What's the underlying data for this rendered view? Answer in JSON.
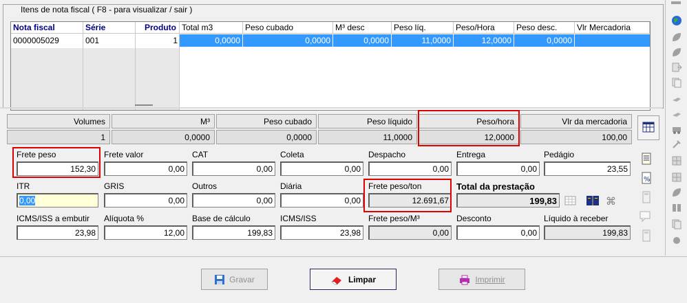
{
  "items_group": {
    "title": "Itens de nota fiscal ( F8 - para visualizar / sair )",
    "columns": [
      "Nota fiscal",
      "Série",
      "Produto",
      "Total m3",
      "Peso cubado",
      "M³ desc",
      "Peso líq.",
      "Peso/Hora",
      "Peso desc.",
      "Vlr Mercadoria"
    ],
    "row": [
      "0000005029",
      "001",
      "1",
      "0,0000",
      "0,0000",
      "0,0000",
      "11,0000",
      "12,0000",
      "0,0000",
      ""
    ]
  },
  "summary": {
    "labels": [
      "Volumes",
      "M³",
      "Peso cubado",
      "Peso líquido",
      "Peso/hora",
      "Vlr da mercadoria"
    ],
    "values": [
      "1",
      "0,0000",
      "0,0000",
      "11,0000",
      "12,0000",
      "100,00"
    ]
  },
  "fields": {
    "frete_peso": {
      "label": "Frete peso",
      "value": "152,30"
    },
    "frete_valor": {
      "label": "Frete valor",
      "value": "0,00"
    },
    "cat": {
      "label": "CAT",
      "value": "0,00"
    },
    "coleta": {
      "label": "Coleta",
      "value": "0,00"
    },
    "despacho": {
      "label": "Despacho",
      "value": "0,00"
    },
    "entrega": {
      "label": "Entrega",
      "value": "0,00"
    },
    "pedagio": {
      "label": "Pedágio",
      "value": "23,55"
    },
    "itr": {
      "label": "ITR",
      "value": "0,00"
    },
    "gris": {
      "label": "GRIS",
      "value": "0,00"
    },
    "outros": {
      "label": "Outros",
      "value": "0,00"
    },
    "diaria": {
      "label": "Diária",
      "value": "0,00"
    },
    "frete_peso_ton": {
      "label": "Frete peso/ton",
      "value": "12.691,67"
    },
    "total_prestacao": {
      "label": "Total da prestação",
      "value": "199,83"
    },
    "icms_embutir": {
      "label": "ICMS/ISS a embutir",
      "value": "23,98"
    },
    "aliquota": {
      "label": "Alíquota %",
      "value": "12,00"
    },
    "base_calculo": {
      "label": "Base de cálculo",
      "value": "199,83"
    },
    "icms_iss": {
      "label": "ICMS/ISS",
      "value": "23,98"
    },
    "frete_peso_m3": {
      "label": "Frete peso/M³",
      "value": "0,00"
    },
    "desconto": {
      "label": "Desconto",
      "value": "0,00"
    },
    "liquido": {
      "label": "Líquido à receber",
      "value": "199,83"
    }
  },
  "buttons": {
    "gravar": "Gravar",
    "limpar": "Limpar",
    "imprimir": "Imprimir"
  },
  "colors": {
    "selection": "#3399ff",
    "highlight_box": "#e00000",
    "header_text": "#000080"
  }
}
